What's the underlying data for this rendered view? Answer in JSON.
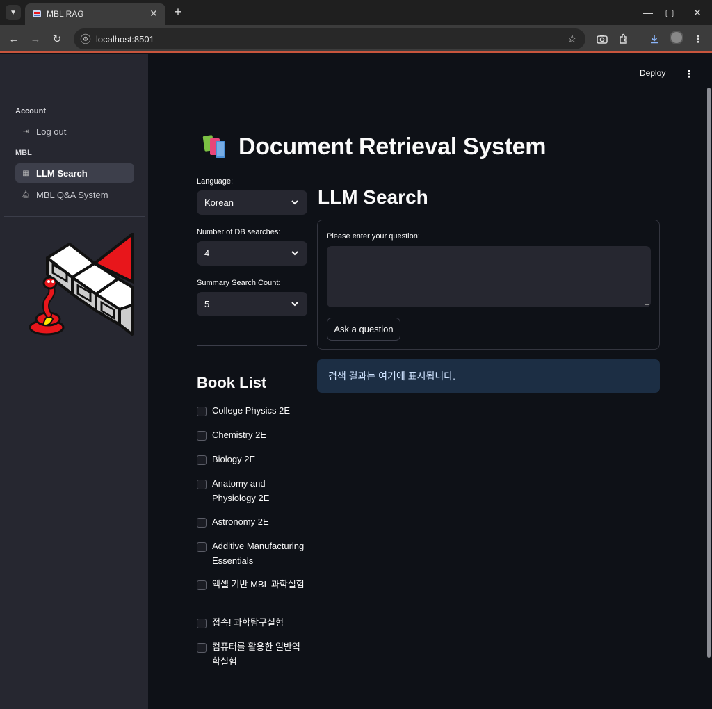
{
  "browser": {
    "tab_title": "MBL RAG",
    "tab_close": "✕",
    "new_tab": "+",
    "url": "localhost:8501",
    "win_min": "—",
    "win_max": "▢",
    "win_close": "✕"
  },
  "header": {
    "deploy_label": "Deploy",
    "menu_glyph": "⋮"
  },
  "sidebar": {
    "account_section": "Account",
    "logout_label": "Log out",
    "mbl_section": "MBL",
    "items": [
      {
        "label": "LLM Search",
        "icon": "grid-icon",
        "active": true
      },
      {
        "label": "MBL Q&A System",
        "icon": "bell-icon",
        "active": false
      }
    ]
  },
  "main": {
    "title": "Document Retrieval System",
    "settings": {
      "language_label": "Language:",
      "language_value": "Korean",
      "db_searches_label": "Number of DB searches:",
      "db_searches_value": "4",
      "summary_count_label": "Summary Search Count:",
      "summary_count_value": "5"
    },
    "book_list": {
      "title": "Book List",
      "books": [
        "College Physics 2E",
        "Chemistry 2E",
        "Biology 2E",
        "Anatomy and Physiology 2E",
        "Astronomy 2E",
        "Additive Manufacturing Essentials",
        "엑셀 기반 MBL 과학실험",
        "접속! 과학탐구실험",
        "컴퓨터를 활용한 일반역학실험"
      ]
    },
    "llm_search": {
      "heading": "LLM Search",
      "question_label": "Please enter your question:",
      "question_value": "",
      "ask_button": "Ask a question",
      "result_placeholder": "검색 결과는 여기에 표시됩니다."
    }
  },
  "colors": {
    "app_bg": "#0e1117",
    "sidebar_bg": "#262730",
    "info_bg": "#1c2e44",
    "accent_red": "#e8161b"
  }
}
